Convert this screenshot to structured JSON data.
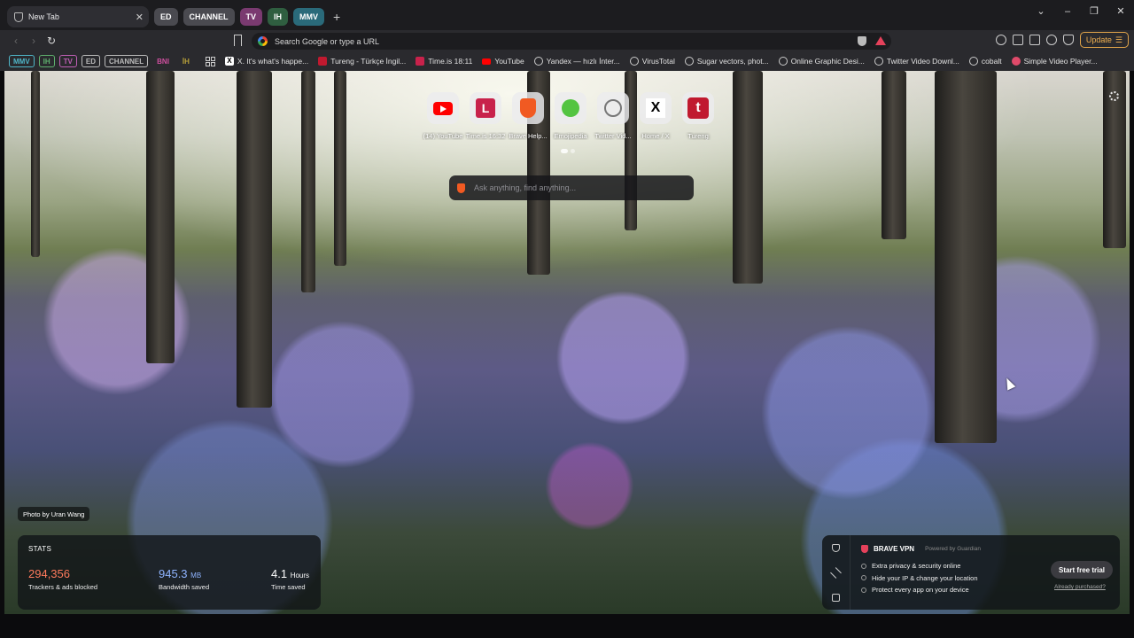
{
  "tabs": {
    "active": {
      "title": "New Tab",
      "close": "✕"
    },
    "groups": [
      {
        "label": "ED",
        "color": "#4a4a50"
      },
      {
        "label": "CHANNEL",
        "color": "#4a4a50"
      },
      {
        "label": "TV",
        "color": "#7a3a70"
      },
      {
        "label": "IH",
        "color": "#2f5e40"
      },
      {
        "label": "MMV",
        "color": "#2a6a7a"
      }
    ],
    "new_tab": "+"
  },
  "window_controls": {
    "list": "⌄",
    "minimize": "–",
    "restore": "❐",
    "close": "✕"
  },
  "toolbar": {
    "back": "‹",
    "forward": "›",
    "reload": "↻",
    "url_placeholder": "Search Google or type a URL",
    "update_label": "Update"
  },
  "bookmarks": {
    "chips": [
      {
        "label": "MMV",
        "color": "#4fb6c8"
      },
      {
        "label": "IH",
        "color": "#5fb06e"
      },
      {
        "label": "TV",
        "color": "#c05fb5"
      },
      {
        "label": "ED",
        "color": "#bbbbbb"
      },
      {
        "label": "CHANNEL",
        "color": "#bbbbbb"
      },
      {
        "label": "BNI",
        "color": "#d04fa0"
      },
      {
        "label": "İH",
        "color": "#b8a03a"
      }
    ],
    "items": [
      {
        "label": "X. It's what's happe...",
        "icon": "x-icon"
      },
      {
        "label": "Tureng - Türkçe İngil...",
        "icon": "tureng-icon"
      },
      {
        "label": "Time.is 18:11",
        "icon": "time-is-icon"
      },
      {
        "label": "YouTube",
        "icon": "youtube-icon"
      },
      {
        "label": "Yandex — hızlı İnter...",
        "icon": "globe-icon"
      },
      {
        "label": "VirusTotal",
        "icon": "globe-icon"
      },
      {
        "label": "Sugar vectors, phot...",
        "icon": "globe-icon"
      },
      {
        "label": "Online Graphic Desi...",
        "icon": "globe-icon"
      },
      {
        "label": "Twitter Video Downl...",
        "icon": "globe-icon"
      },
      {
        "label": "cobalt",
        "icon": "globe-icon"
      },
      {
        "label": "Simple Video Player...",
        "icon": "simple-video-player-icon"
      }
    ]
  },
  "top_sites": [
    {
      "label": "(14) YouTube",
      "icon": "youtube-icon"
    },
    {
      "label": "Time.is 16:32",
      "icon": "time-is-icon"
    },
    {
      "label": "Brave Help...",
      "icon": "brave-icon"
    },
    {
      "label": "Emojipedia",
      "icon": "emoji-icon"
    },
    {
      "label": "Twitter Vid...",
      "icon": "globe-icon"
    },
    {
      "label": "Home / X",
      "icon": "x-icon"
    },
    {
      "label": "Tureng",
      "icon": "tureng-icon"
    }
  ],
  "search": {
    "placeholder": "Ask anything, find anything..."
  },
  "photo_credit": "Photo by Uran Wang",
  "stats": {
    "title": "STATS",
    "trackers": {
      "value": "294,356",
      "caption": "Trackers & ads blocked",
      "color": "#ff7a5c"
    },
    "bandwidth": {
      "value": "945.3",
      "unit": "MB",
      "caption": "Bandwidth saved",
      "color": "#8fb4ff"
    },
    "time": {
      "value": "4.1",
      "unit": "Hours",
      "caption": "Time saved",
      "color": "#ffffff"
    }
  },
  "vpn": {
    "title": "BRAVE VPN",
    "powered": "Powered by Guardian",
    "features": [
      "Extra privacy & security online",
      "Hide your IP & change your location",
      "Protect every app on your device"
    ],
    "cta": "Start free trial",
    "purchased": "Already purchased?"
  }
}
